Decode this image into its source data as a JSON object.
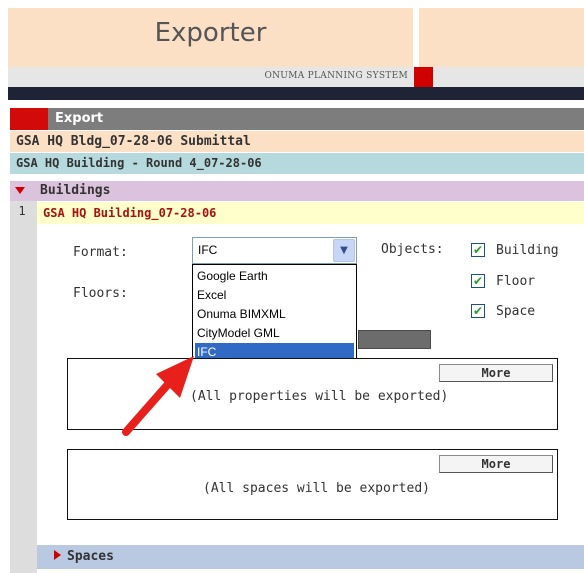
{
  "header": {
    "title": "Exporter",
    "system_name": "ONUMA PLANNING SYSTEM"
  },
  "export": {
    "label": "Export"
  },
  "submittal": "GSA HQ Bldg_07-28-06 Submittal",
  "round": "GSA HQ Building - Round 4_07-28-06",
  "buildings": {
    "label": "Buildings",
    "expanded_icon": "triangle-down-icon"
  },
  "building_row": {
    "index": "1",
    "name": "GSA HQ Building_07-28-06"
  },
  "form": {
    "format_label": "Format:",
    "format_value": "IFC",
    "floors_label": "Floors:",
    "objects_label": "Objects:",
    "format_options": [
      {
        "label": "Google Earth"
      },
      {
        "label": "Excel"
      },
      {
        "label": "Onuma BIMXML"
      },
      {
        "label": "CityModel GML"
      },
      {
        "label": "IFC"
      }
    ],
    "selected_option": "IFC",
    "objects": [
      {
        "label": "Building",
        "checked": true
      },
      {
        "label": "Floor",
        "checked": true
      },
      {
        "label": "Space",
        "checked": true
      }
    ]
  },
  "properties_panel": {
    "more_label": "More",
    "note": "(All properties will be exported)"
  },
  "spaces_panel": {
    "more_label": "More",
    "note": "(All spaces will be exported)"
  },
  "spaces": {
    "label": "Spaces",
    "collapsed_icon": "triangle-right-icon"
  },
  "colors": {
    "header_bg": "#fbe0c6",
    "accent_red": "#d10000",
    "dark_bar": "#1e2436",
    "export_bar": "#7d7d7d",
    "round_row": "#b5d9dc",
    "buildings_row": "#dcc3dd",
    "building_row": "#ffffcc",
    "spaces_row": "#b9c9e2",
    "selection": "#316ac5",
    "annotation_arrow": "#e8201b"
  }
}
